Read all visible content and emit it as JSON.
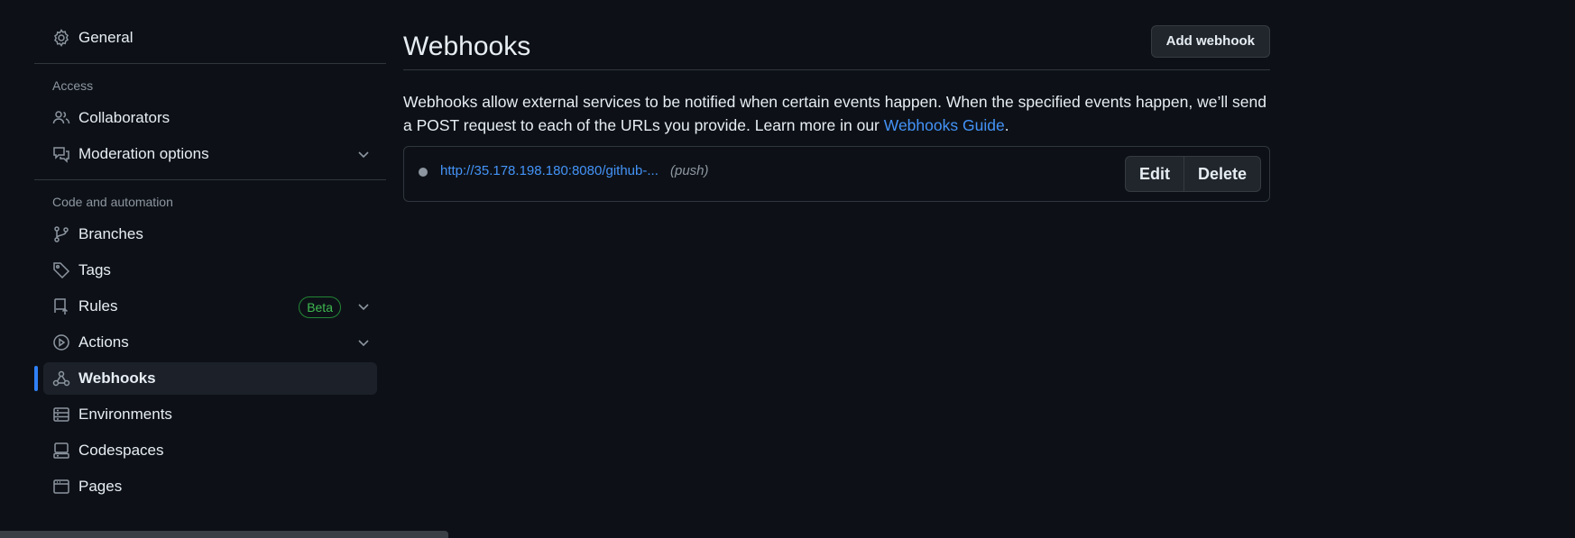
{
  "sidebar": {
    "general": "General",
    "access_heading": "Access",
    "collaborators": "Collaborators",
    "moderation": "Moderation options",
    "code_heading": "Code and automation",
    "branches": "Branches",
    "tags": "Tags",
    "rules": "Rules",
    "rules_badge": "Beta",
    "actions": "Actions",
    "webhooks": "Webhooks",
    "environments": "Environments",
    "codespaces": "Codespaces",
    "pages": "Pages"
  },
  "main": {
    "title": "Webhooks",
    "add_button": "Add webhook",
    "description": "Webhooks allow external services to be notified when certain events happen. When the specified events happen, we’ll send a POST request to each of the URLs you provide. Learn more in our ",
    "guide_link": "Webhooks Guide",
    "description_end": ".",
    "hook": {
      "url": "http://35.178.198.180:8080/github-...",
      "event": "(push)",
      "edit_label": "Edit",
      "delete_label": "Delete"
    }
  },
  "colors": {
    "background": "#0d1117",
    "accent": "#2f81f7",
    "link": "#4493f8",
    "badge_green": "#3fb950"
  }
}
